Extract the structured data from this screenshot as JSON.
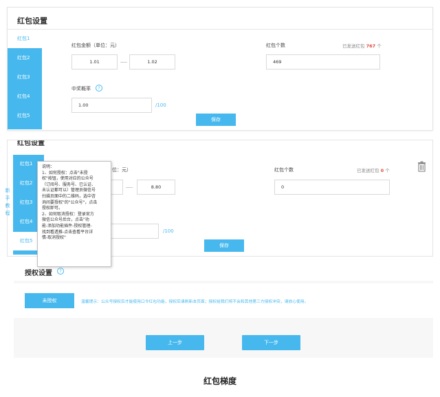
{
  "panel1": {
    "title": "红包设置",
    "tabs": [
      "红包1",
      "红包2",
      "红包3",
      "红包4",
      "红包5"
    ],
    "amount_label": "红包金额（单位：元）",
    "amount_min": "1.01",
    "amount_max": "1.02",
    "count_label": "红包个数",
    "sent_prefix": "已发送红包",
    "sent_count": "767",
    "sent_suffix": "个",
    "count_value": "469",
    "prob_label": "中奖概率",
    "prob_value": "1.00",
    "prob_total": "/100",
    "save_label": "保存"
  },
  "panel2": {
    "title": "红包设置",
    "tabs": [
      "红包1",
      "红包2",
      "红包3",
      "红包4",
      "红包5"
    ],
    "amount_label_partial": "位：元）",
    "amount_max": "8.80",
    "count_label": "红包个数",
    "sent_prefix": "已发送红包",
    "sent_count": "0",
    "sent_suffix": "个",
    "count_value": "0",
    "prob_total": "/100",
    "save_label": "保存",
    "side_guide": [
      "新",
      "手",
      "教",
      "程"
    ],
    "tooltip": "说明：\n1、如何授权：点击\"未授\n权\"按钮，使用对应的公众号\n（订阅号、服务号、已认证、\n未认证都可以）管理员微信号\n扫描页面中的二维码，选中咨\n询间要授权\"的\"公众号\"，点击\n授权即可。\n2、如何取消授权：登录官方\n微信公众号后台，点击\"功\n能-添加功能插件-授权管理-\n找到看透推-点击查看平台详\n情-取消授权\""
  },
  "auth": {
    "title": "授权设置",
    "button_label": "未授权",
    "tip": "温馨提示：公众号授权后才能使用口令红包功能，授权后请刷新本页面；授权给我们将不会和其他第三方授权冲突，请放心使用。"
  },
  "nav": {
    "prev_label": "上一步",
    "next_label": "下一步"
  },
  "caption": "红包梯度",
  "colors": {
    "accent": "#46b8ee",
    "highlight": "#e24a3a"
  },
  "icons": {
    "help": "help-circle-icon",
    "delete": "trash-icon"
  }
}
